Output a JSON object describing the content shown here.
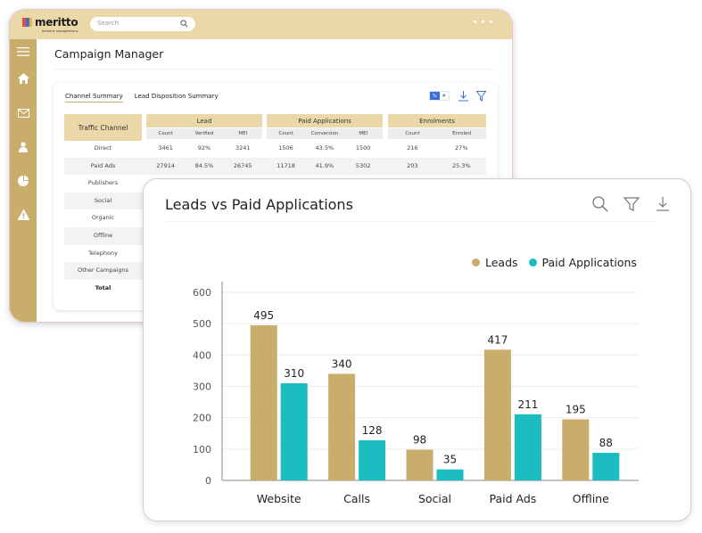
{
  "app": {
    "logo_text": "meritto",
    "logo_sub": "formerly nopaperforms",
    "search_placeholder": "Search",
    "sidebar": [
      "menu-icon",
      "home-icon",
      "mail-icon",
      "user-icon",
      "pie-chart-icon",
      "alert-icon"
    ]
  },
  "page": {
    "title": "Campaign Manager"
  },
  "summary": {
    "tabs": [
      {
        "label": "Channel Summary",
        "active": true
      },
      {
        "label": "Lead Disposition Summary",
        "active": false
      }
    ],
    "toggle": {
      "percent": "%",
      "count": "#"
    },
    "traffic_channel_header": "Traffic Channel",
    "groups": [
      {
        "title": "Lead",
        "columns": [
          "Count",
          "Verified",
          "MEI"
        ]
      },
      {
        "title": "Paid Applications",
        "columns": [
          "Count",
          "Conversion",
          "MEI"
        ]
      },
      {
        "title": "Enrolments",
        "columns": [
          "Count",
          "Enroled"
        ]
      }
    ],
    "rows": [
      {
        "channel": "Direct",
        "lead": [
          "3461",
          "92%",
          "3241"
        ],
        "paid": [
          "1506",
          "43.5%",
          "1500"
        ],
        "enrol": [
          "216",
          "27%"
        ]
      },
      {
        "channel": "Paid Ads",
        "lead": [
          "27914",
          "84.5%",
          "26745"
        ],
        "paid": [
          "11718",
          "41.9%",
          "5302"
        ],
        "enrol": [
          "203",
          "25.3%"
        ]
      },
      {
        "channel": "Publishers",
        "lead": [
          "",
          "",
          ""
        ],
        "paid": [
          "",
          "",
          ""
        ],
        "enrol": [
          "",
          ""
        ]
      },
      {
        "channel": "Social",
        "lead": [
          "",
          "",
          ""
        ],
        "paid": [
          "",
          "",
          ""
        ],
        "enrol": [
          "",
          ""
        ]
      },
      {
        "channel": "Organic",
        "lead": [
          "",
          "",
          ""
        ],
        "paid": [
          "",
          "",
          ""
        ],
        "enrol": [
          "",
          ""
        ]
      },
      {
        "channel": "Offline",
        "lead": [
          "",
          "",
          ""
        ],
        "paid": [
          "",
          "",
          ""
        ],
        "enrol": [
          "",
          ""
        ]
      },
      {
        "channel": "Telephony",
        "lead": [
          "",
          "",
          ""
        ],
        "paid": [
          "",
          "",
          ""
        ],
        "enrol": [
          "",
          ""
        ]
      },
      {
        "channel": "Other Campaigns",
        "lead": [
          "",
          "",
          ""
        ],
        "paid": [
          "",
          "",
          ""
        ],
        "enrol": [
          "",
          ""
        ]
      },
      {
        "channel": "Total",
        "lead": [
          "",
          "",
          ""
        ],
        "paid": [
          "",
          "",
          ""
        ],
        "enrol": [
          "",
          ""
        ]
      }
    ]
  },
  "chart_panel": {
    "title": "Leads vs Paid Applications",
    "icons": [
      "search-icon",
      "filter-icon",
      "download-icon"
    ]
  },
  "colors": {
    "leads": "#c9ad6a",
    "paid": "#1bbdc0",
    "topbar": "#ebd8a8",
    "sidebar": "#c9ad6a",
    "accent_blue": "#3a6fd8"
  },
  "chart_data": {
    "type": "bar",
    "title": "Leads vs Paid Applications",
    "categories": [
      "Website",
      "Calls",
      "Social",
      "Paid Ads",
      "Offline"
    ],
    "series": [
      {
        "name": "Leads",
        "values": [
          495,
          340,
          98,
          417,
          195
        ]
      },
      {
        "name": "Paid Applications",
        "values": [
          310,
          128,
          35,
          211,
          88
        ]
      }
    ],
    "yticks": [
      0,
      100,
      200,
      300,
      400,
      500,
      600
    ],
    "ylim": [
      0,
      600
    ],
    "xlabel": "",
    "ylabel": "",
    "grid": true,
    "legend": "top-right"
  }
}
